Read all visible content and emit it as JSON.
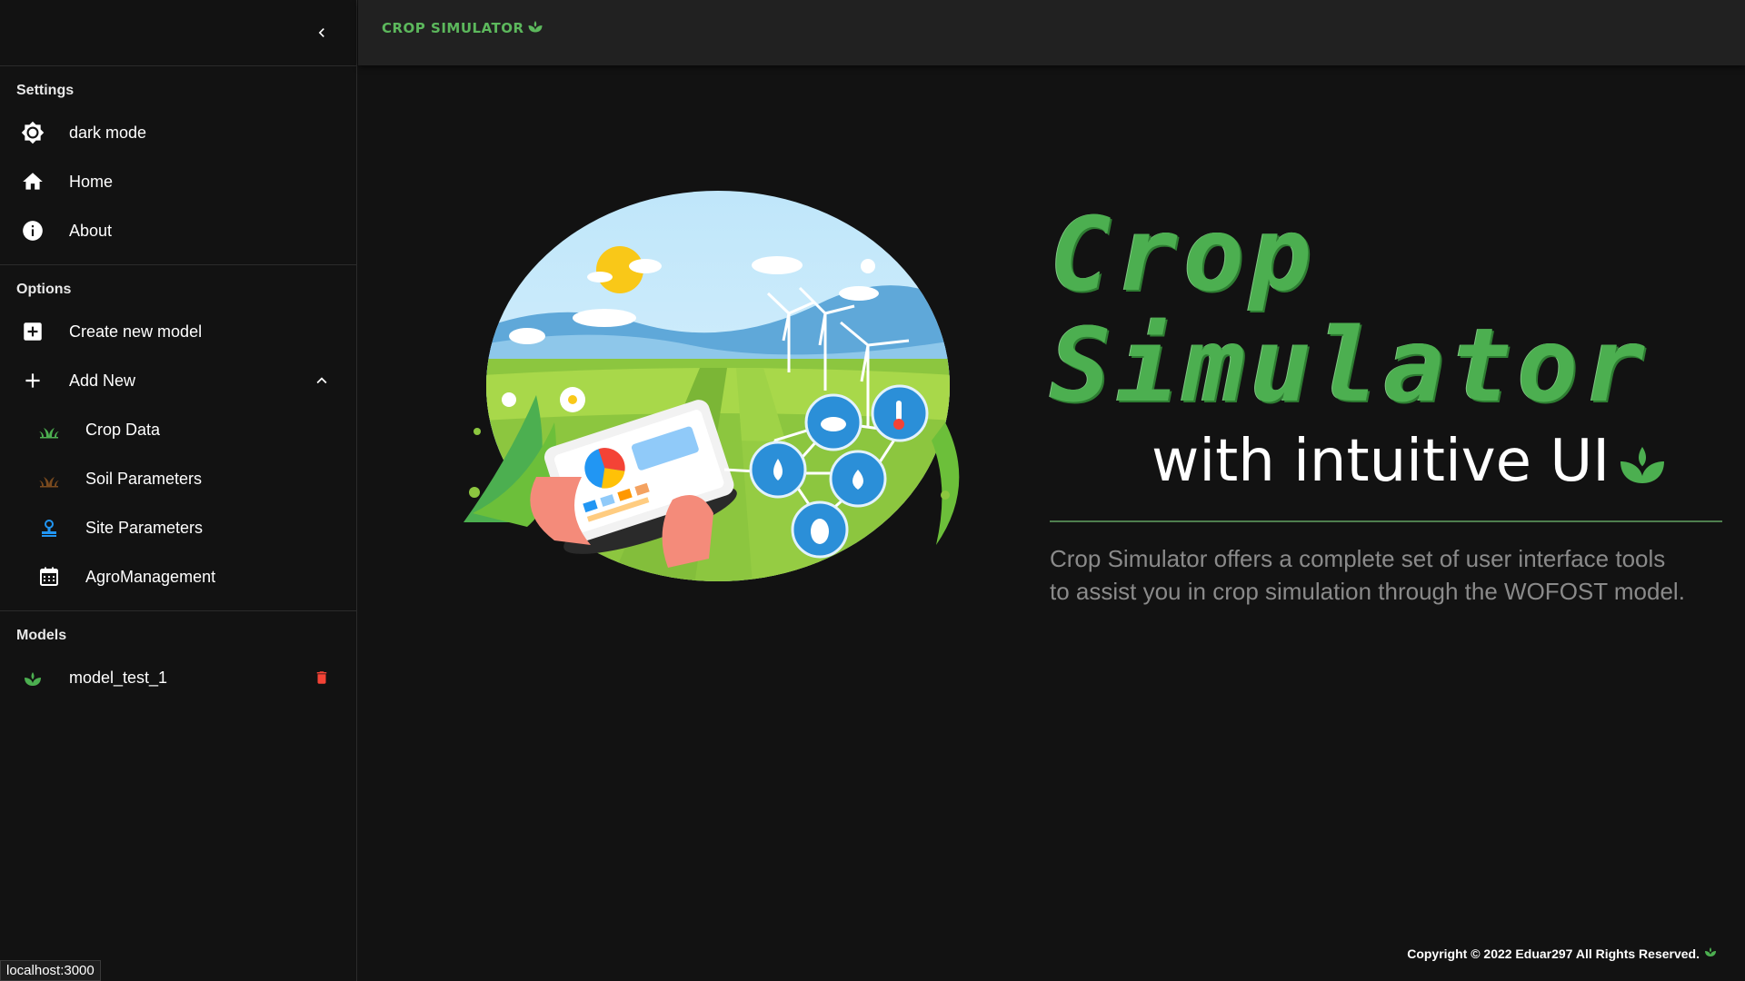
{
  "brand": {
    "name": "CROP SIMULATOR",
    "color": "#5cb85c",
    "icon": "sprout-icon"
  },
  "sidebar": {
    "collapse_icon": "chevron-left-icon",
    "sections": {
      "settings": {
        "title": "Settings",
        "items": [
          {
            "label": "dark mode",
            "icon": "brightness-icon"
          },
          {
            "label": "Home",
            "icon": "home-icon"
          },
          {
            "label": "About",
            "icon": "info-icon"
          }
        ]
      },
      "options": {
        "title": "Options",
        "items": [
          {
            "label": "Create new model",
            "icon": "add-box-icon"
          },
          {
            "label": "Add New",
            "icon": "plus-icon",
            "expanded": true
          },
          {
            "label": "Crop Data",
            "icon": "crop-icon"
          },
          {
            "label": "Soil Parameters",
            "icon": "soil-icon"
          },
          {
            "label": "Site Parameters",
            "icon": "site-icon"
          },
          {
            "label": "AgroManagement",
            "icon": "calendar-icon"
          }
        ]
      },
      "models": {
        "title": "Models",
        "items": [
          {
            "label": "model_test_1",
            "icon": "sprout-icon",
            "action_icon": "trash-icon"
          }
        ]
      }
    }
  },
  "hero": {
    "title_line1": "Crop",
    "title_line2": "Simulator",
    "subtitle": "with intuitive UI",
    "description_line1": "Crop Simulator offers a complete set of user interface tools",
    "description_line2": "to assist you in crop simulation through the WOFOST model."
  },
  "footer": {
    "copyright": "Copyright © 2022 Eduar297 All Rights Reserved."
  },
  "status_bar": {
    "url": "localhost:3000"
  },
  "colors": {
    "accent_green": "#4caf50",
    "background": "#121212",
    "appbar": "#212121",
    "delete_red": "#f44336",
    "site_blue": "#2196f3"
  }
}
